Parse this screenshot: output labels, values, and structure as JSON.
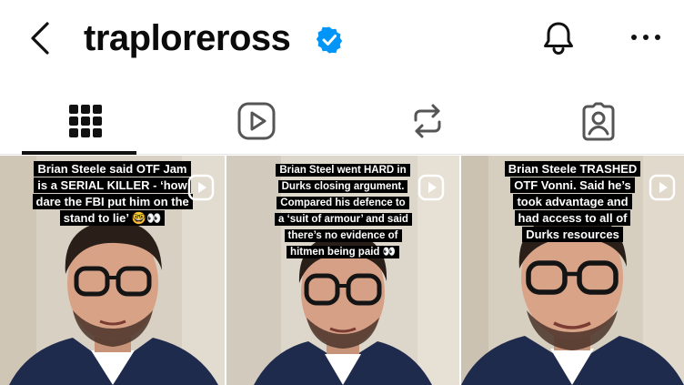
{
  "header": {
    "username": "traploreross",
    "verified": true
  },
  "tabs": [
    {
      "icon": "grid-icon",
      "active": true
    },
    {
      "icon": "reels-icon",
      "active": false
    },
    {
      "icon": "reposts-icon",
      "active": false
    },
    {
      "icon": "tagged-icon",
      "active": false
    }
  ],
  "posts": [
    {
      "caption": "Brian Steele said OTF Jam is a SERIAL KILLER - ‘how dare the FBI put him on the stand to lie’ 🤓👀",
      "type": "reel"
    },
    {
      "caption": "Brian Steel went HARD in Durks closing argument. Compared his defence to a ‘suit of armour’ and said there’s no evidence of hitmen being paid 👀",
      "type": "reel"
    },
    {
      "caption": "Brian Steele TRASHED OTF Vonni. Said he’s took advantage and had access to all of Durks resources",
      "type": "reel"
    }
  ],
  "colors": {
    "verified_blue": "#0095f6",
    "text": "#0b0b0b",
    "caption_bg": "#000000"
  }
}
